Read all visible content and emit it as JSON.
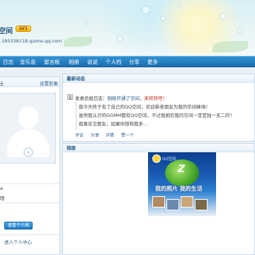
{
  "header": {
    "space_name": "空间",
    "vip_label": "LV1",
    "url": "185338118.qzone.qq.com"
  },
  "nav": {
    "items": [
      "日志",
      "音乐盒",
      "留言板",
      "相册",
      "说说",
      "个人档",
      "分享",
      "更多"
    ]
  },
  "sidebar": {
    "head_title": "士",
    "settings_label": "设置形象",
    "info_line_1": "a",
    "info_line_2": "阳",
    "profile_button": "查看个人档",
    "center_link": "进入个人中心"
  },
  "feed": {
    "panel_title": "最新动态",
    "headline_prefix": "发表信纸日志：",
    "headline_link": "刚刚开通了空间，",
    "headline_tail": "来转转吧！",
    "quote_lines": [
      "我今天终于有了自己的QQ空间，欢迎新老朋友为我的空间捧场！",
      "虽然我认识的GGMM都有QQ空间，不过我相信我的空间一定是独一无二的！",
      "我喜欢交朋友，如果你想和我多..."
    ],
    "actions": [
      "评论",
      "分享",
      "详情",
      "赞一个"
    ]
  },
  "album": {
    "panel_title": "相册",
    "image_brand": "QQ空间",
    "image_slogan": "我的照片 我的生活",
    "image_letter": "Z"
  },
  "colors": {
    "nav_bg": "#1c6fb0",
    "link": "#2b5d8a",
    "accent_red": "#c0392b",
    "vip_gold": "#f4b20a"
  }
}
